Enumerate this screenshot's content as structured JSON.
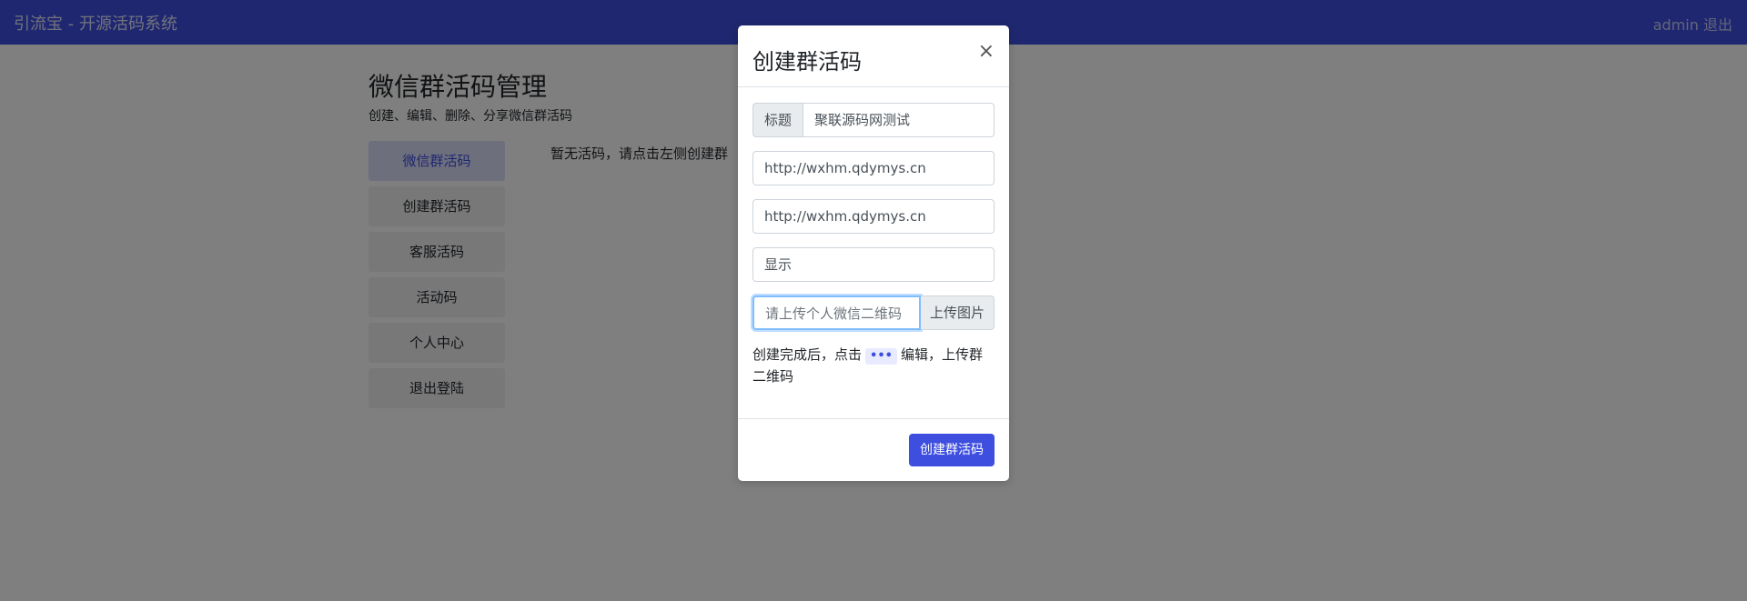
{
  "navbar": {
    "brand": "引流宝 - 开源活码系统",
    "user": "admin",
    "logout": "退出",
    "color": "#3e4fe0"
  },
  "page": {
    "title": "微信群活码管理",
    "subtitle": "创建、编辑、删除、分享微信群活码",
    "empty_note": "暂无活码，请点击左侧创建群"
  },
  "sidebar": {
    "items": [
      {
        "label": "微信群活码",
        "active": true
      },
      {
        "label": "创建群活码"
      },
      {
        "label": "客服活码"
      },
      {
        "label": "活动码"
      },
      {
        "label": "个人中心"
      },
      {
        "label": "退出登陆"
      }
    ]
  },
  "modal": {
    "title": "创建群活码",
    "close_symbol": "×",
    "title_field": {
      "addon": "标题",
      "value": "聚联源码网测试"
    },
    "url_field_1": {
      "value": "http://wxhm.qdymys.cn"
    },
    "url_field_2": {
      "value": "http://wxhm.qdymys.cn"
    },
    "display_field": {
      "value": "显示"
    },
    "upload_field": {
      "placeholder": "请上传个人微信二维码",
      "button": "上传图片"
    },
    "hint_before": "创建完成后，点击",
    "hint_badge": "•••",
    "hint_after": "编辑，上传群二维码",
    "submit": "创建群活码"
  }
}
